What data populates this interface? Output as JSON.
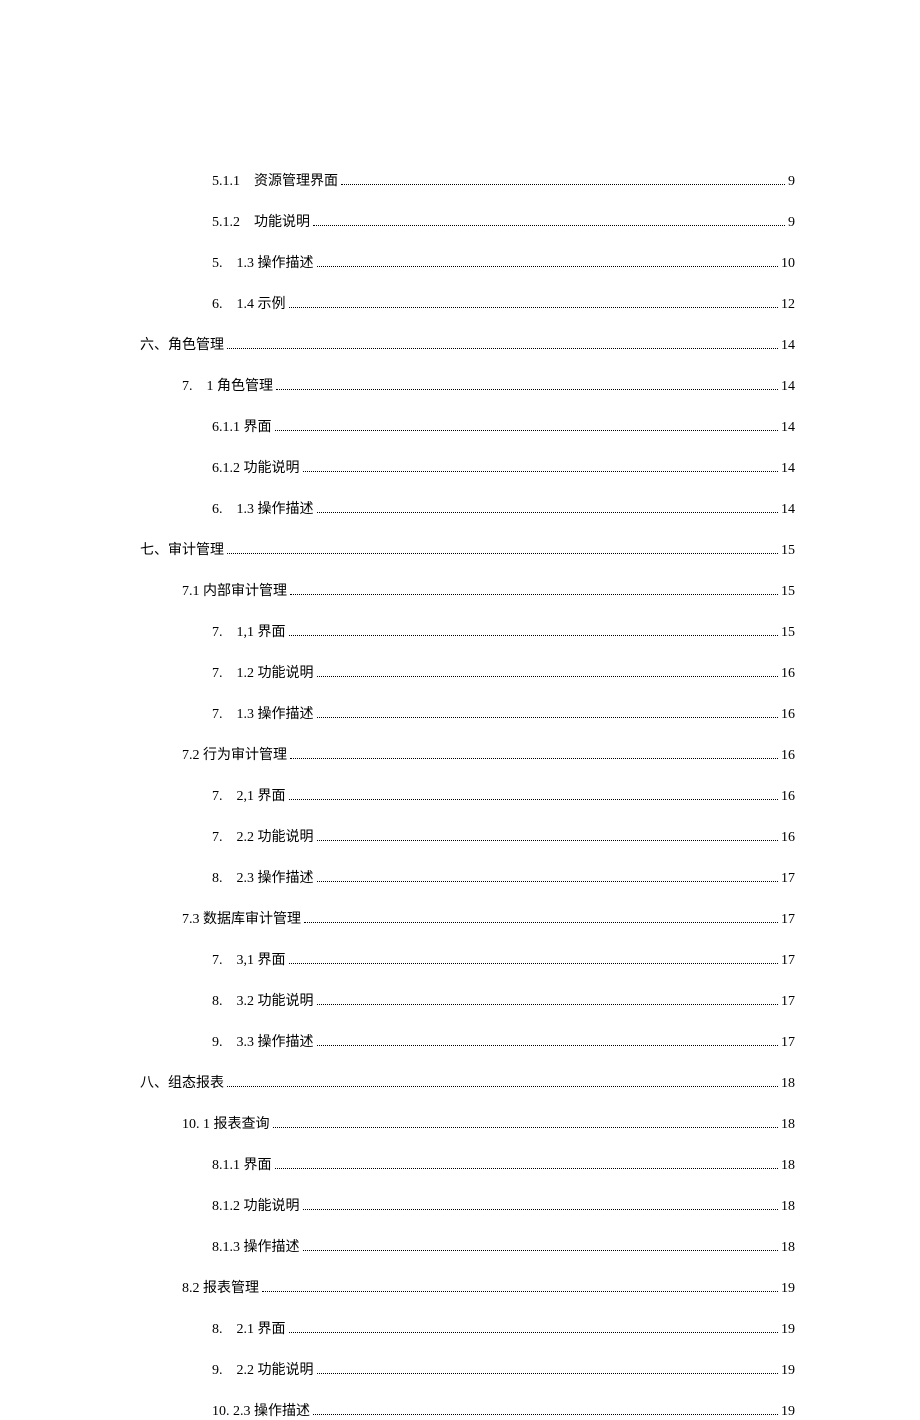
{
  "toc": [
    {
      "indent": 3,
      "label": "5.1.1　资源管理界面",
      "page": "9"
    },
    {
      "indent": 3,
      "label": "5.1.2　功能说明",
      "page": "9"
    },
    {
      "indent": 3,
      "label": "5.　1.3 操作描述",
      "page": "10"
    },
    {
      "indent": 3,
      "label": "6.　1.4 示例",
      "page": "12"
    },
    {
      "indent": 1,
      "label": "六、角色管理",
      "page": "14"
    },
    {
      "indent": 2,
      "label": "7.　1 角色管理",
      "page": "14"
    },
    {
      "indent": 3,
      "label": "6.1.1 界面",
      "page": "14"
    },
    {
      "indent": 3,
      "label": "6.1.2 功能说明",
      "page": "14"
    },
    {
      "indent": 3,
      "label": "6.　1.3 操作描述",
      "page": "14"
    },
    {
      "indent": 1,
      "label": "七、审计管理",
      "page": "15"
    },
    {
      "indent": 2,
      "label": "7.1 内部审计管理",
      "page": "15"
    },
    {
      "indent": 3,
      "label": "7.　1,1 界面",
      "page": "15"
    },
    {
      "indent": 3,
      "label": "7.　1.2 功能说明",
      "page": "16"
    },
    {
      "indent": 3,
      "label": "7.　1.3 操作描述",
      "page": "16"
    },
    {
      "indent": 2,
      "label": "7.2 行为审计管理",
      "page": "16"
    },
    {
      "indent": 3,
      "label": "7.　2,1 界面",
      "page": "16"
    },
    {
      "indent": 3,
      "label": "7.　2.2 功能说明",
      "page": "16"
    },
    {
      "indent": 3,
      "label": "8.　2.3 操作描述",
      "page": "17"
    },
    {
      "indent": 2,
      "label": "7.3 数据库审计管理",
      "page": "17"
    },
    {
      "indent": 3,
      "label": "7.　3,1 界面",
      "page": "17"
    },
    {
      "indent": 3,
      "label": "8.　3.2 功能说明",
      "page": "17"
    },
    {
      "indent": 3,
      "label": "9.　3.3 操作描述",
      "page": "17"
    },
    {
      "indent": 1,
      "label": "八、组态报表",
      "page": "18"
    },
    {
      "indent": 2,
      "label": "10. 1 报表查询",
      "page": "18"
    },
    {
      "indent": 3,
      "label": "8.1.1 界面",
      "page": "18"
    },
    {
      "indent": 3,
      "label": "8.1.2 功能说明",
      "page": "18"
    },
    {
      "indent": 3,
      "label": "8.1.3 操作描述",
      "page": "18"
    },
    {
      "indent": 2,
      "label": "8.2 报表管理",
      "page": "19"
    },
    {
      "indent": 3,
      "label": "8.　2.1 界面",
      "page": "19"
    },
    {
      "indent": 3,
      "label": "9.　2.2 功能说明",
      "page": "19"
    },
    {
      "indent": 3,
      "label": "10. 2.3 操作描述",
      "page": "19"
    }
  ]
}
